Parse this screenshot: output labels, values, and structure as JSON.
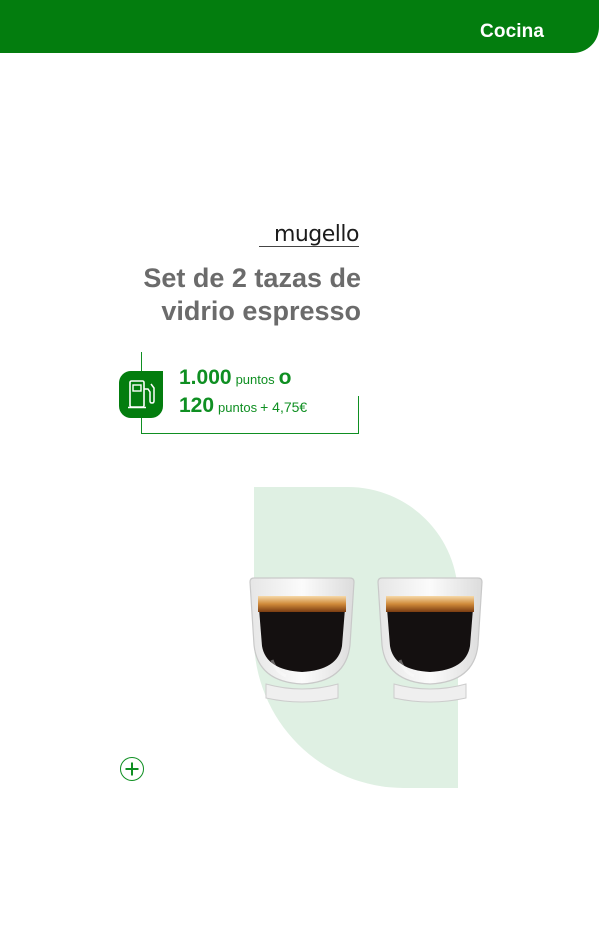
{
  "header": {
    "category": "Cocina"
  },
  "product": {
    "brand": "mugello",
    "title_line1": "Set de 2 tazas de",
    "title_line2": "vidrio espresso"
  },
  "price": {
    "option1_points": "1.000",
    "option1_unit": "puntos",
    "separator": "o",
    "option2_points": "120",
    "option2_unit": "puntos",
    "option2_extra": "+ 4,75€"
  },
  "colors": {
    "brand_green": "#037d0e",
    "accent_green": "#0f8f22",
    "title_gray": "#6b6b6b",
    "image_background": "#dff0e3"
  },
  "icons": {
    "price_badge": "fuel-pump-icon",
    "more": "plus-circle-icon"
  }
}
